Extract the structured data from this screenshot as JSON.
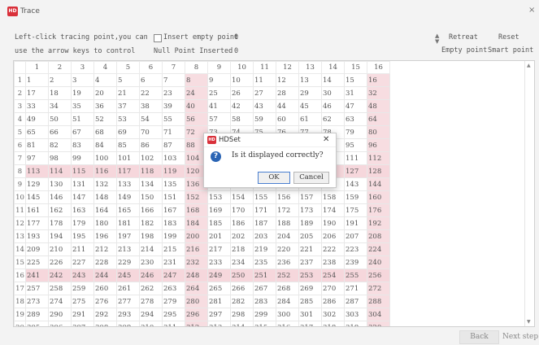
{
  "window": {
    "title": "Trace",
    "app_icon_text": "HD",
    "close_glyph": "×"
  },
  "options": {
    "instruction_line1": "Left-click tracing point,you can",
    "instruction_line2": "use the arrow keys to control",
    "insert_empty_label": "Insert empty point",
    "insert_empty_count": "0",
    "null_point_label": "Null Point Inserted",
    "null_point_count": "0",
    "retreat_label": "Retreat",
    "reset_label": "Reset",
    "empty_point_label": "Empty point",
    "smart_point_label": "Smart point"
  },
  "grid": {
    "columns": [
      "1",
      "2",
      "3",
      "4",
      "5",
      "6",
      "7",
      "8",
      "9",
      "10",
      "11",
      "12",
      "13",
      "14",
      "15",
      "16"
    ],
    "rows": [
      "1",
      "2",
      "3",
      "4",
      "5",
      "6",
      "7",
      "8",
      "9",
      "10",
      "11",
      "12",
      "13",
      "14",
      "15",
      "16",
      "17",
      "18",
      "19",
      "20"
    ],
    "highlight_rows": [
      8,
      16
    ],
    "highlight_cols": [
      8,
      16
    ]
  },
  "footer": {
    "back_label": "Back",
    "next_label": "Next step"
  },
  "dialog": {
    "title": "HDSet",
    "icon_text": "HD",
    "message": "Is it displayed correctly?",
    "ok_label": "OK",
    "cancel_label": "Cancel",
    "close_glyph": "✕"
  }
}
